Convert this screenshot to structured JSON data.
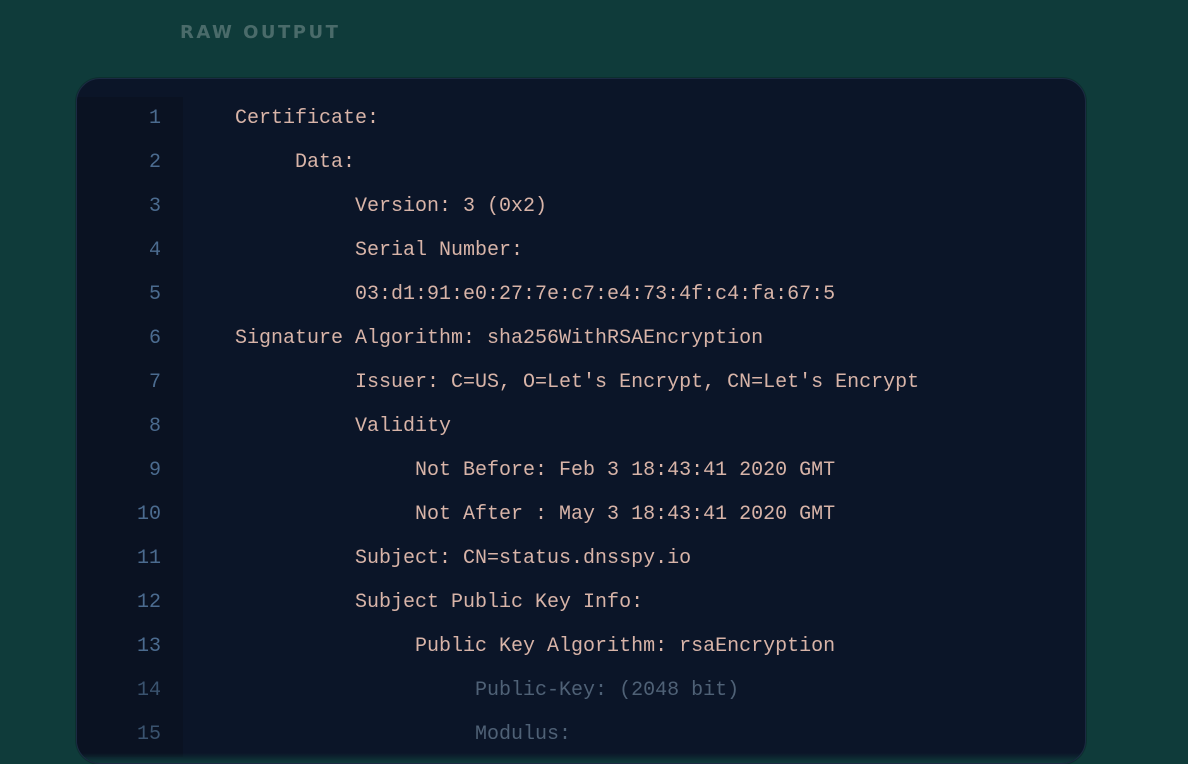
{
  "heading": "RAW OUTPUT",
  "lines": [
    {
      "num": 1,
      "indent": 0,
      "text": "Certificate:",
      "faded": false
    },
    {
      "num": 2,
      "indent": 1,
      "text": "Data:",
      "faded": false
    },
    {
      "num": 3,
      "indent": 2,
      "text": "Version: 3 (0x2)",
      "faded": false
    },
    {
      "num": 4,
      "indent": 2,
      "text": "Serial Number:",
      "faded": false
    },
    {
      "num": 5,
      "indent": 2,
      "text": "03:d1:91:e0:27:7e:c7:e4:73:4f:c4:fa:67:5",
      "faded": false
    },
    {
      "num": 6,
      "indent": 0,
      "text": "Signature Algorithm: sha256WithRSAEncryption",
      "faded": false
    },
    {
      "num": 7,
      "indent": 2,
      "text": "Issuer: C=US, O=Let's Encrypt, CN=Let's Encrypt",
      "faded": false
    },
    {
      "num": 8,
      "indent": 2,
      "text": "Validity",
      "faded": false
    },
    {
      "num": 9,
      "indent": 3,
      "text": "Not Before: Feb 3 18:43:41 2020 GMT",
      "faded": false
    },
    {
      "num": 10,
      "indent": 3,
      "text": "Not After : May 3 18:43:41 2020 GMT",
      "faded": false
    },
    {
      "num": 11,
      "indent": 2,
      "text": "Subject: CN=status.dnsspy.io",
      "faded": false
    },
    {
      "num": 12,
      "indent": 2,
      "text": "Subject Public Key Info:",
      "faded": false
    },
    {
      "num": 13,
      "indent": 3,
      "text": "Public Key Algorithm: rsaEncryption",
      "faded": false
    },
    {
      "num": 14,
      "indent": 4,
      "text": "Public-Key: (2048 bit)",
      "faded": true
    },
    {
      "num": 15,
      "indent": 4,
      "text": "Modulus:",
      "faded": true
    }
  ],
  "indent_unit": "     ",
  "colors": {
    "page_bg": "#0f3b3a",
    "panel_bg": "#0b1528",
    "panel_border": "#1b2a42",
    "gutter_bg": "#0a1222",
    "gutter_fg": "#4b6b8f",
    "code_fg": "#d8b4a8",
    "code_fg_faded": "#4f6176",
    "heading_fg": "#4a6b6a"
  }
}
